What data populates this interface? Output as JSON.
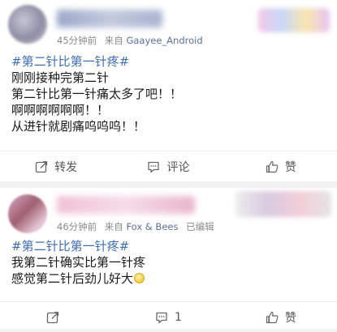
{
  "posts": [
    {
      "meta": {
        "time": "45分钟前",
        "source_prefix": "来自",
        "source": "Gaayee_Android",
        "edited": ""
      },
      "hashtag": "#第二针比第一针疼#",
      "lines": [
        "刚刚接种完第二针",
        "第二针比第一针痛太多了吧！！",
        "啊啊啊啊啊啊！！",
        "从进针就剧痛呜呜呜！！"
      ],
      "actions": {
        "repost": "转发",
        "comment": "评论",
        "like": "赞"
      }
    },
    {
      "meta": {
        "time": "46分钟前",
        "source_prefix": "来自",
        "source": "Fox & Bees",
        "edited": "已编辑"
      },
      "hashtag": "#第二针比第一针疼#",
      "lines": [
        "我第二针确实比第一针疼",
        "感觉第二针后劲儿好大"
      ],
      "actions": {
        "repost": "",
        "comment": "1",
        "like": "赞"
      }
    }
  ],
  "icons": {
    "repost": "share-icon",
    "comment": "comment-icon",
    "like": "thumbs-up-icon",
    "emoji": "grin-emoji-icon"
  }
}
